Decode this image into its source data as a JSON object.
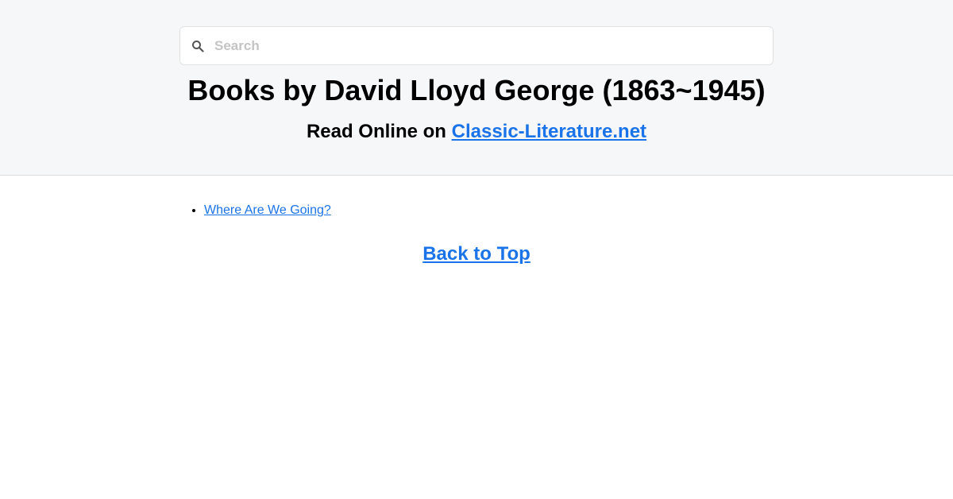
{
  "search": {
    "placeholder": "Search",
    "value": ""
  },
  "header": {
    "title": "Books by David Lloyd George (1863~1945)",
    "subtitle_prefix": "Read Online on ",
    "site_link": "Classic-Literature.net"
  },
  "books": [
    {
      "title": "Where Are We Going?"
    }
  ],
  "footer": {
    "back_to_top": "Back to Top"
  },
  "colors": {
    "link": "#1a73e8",
    "header_bg": "#f6f7f9"
  },
  "icons": {
    "search": "search-icon"
  }
}
